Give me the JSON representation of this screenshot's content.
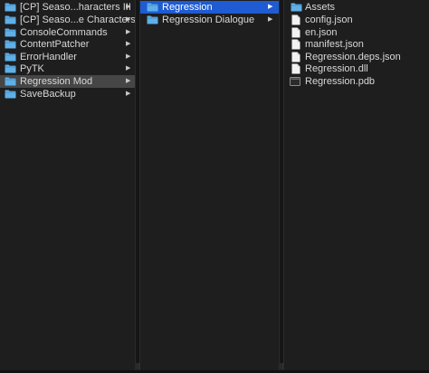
{
  "colors": {
    "background": "#1e1e1f",
    "selected_inactive": "#464646",
    "selected_active": "#1f5bd2",
    "folder": "#5fb0e6",
    "text": "#d8d8d8"
  },
  "column1": {
    "items": [
      {
        "label": "[CP] Seaso...haracters III",
        "icon": "folder-icon",
        "chevron": "▶"
      },
      {
        "label": "[CP] Seaso...e Characters",
        "icon": "folder-icon",
        "chevron": "▶"
      },
      {
        "label": "ConsoleCommands",
        "icon": "folder-icon",
        "chevron": "▶"
      },
      {
        "label": "ContentPatcher",
        "icon": "folder-icon",
        "chevron": "▶"
      },
      {
        "label": "ErrorHandler",
        "icon": "folder-icon",
        "chevron": "▶"
      },
      {
        "label": "PyTK",
        "icon": "folder-icon",
        "chevron": "▶"
      },
      {
        "label": "Regression Mod",
        "icon": "folder-icon",
        "chevron": "▶",
        "selected": "inactive"
      },
      {
        "label": "SaveBackup",
        "icon": "folder-icon",
        "chevron": "▶"
      }
    ]
  },
  "column2": {
    "items": [
      {
        "label": "Regression",
        "icon": "folder-icon",
        "chevron": "▶",
        "selected": "active"
      },
      {
        "label": "Regression Dialogue",
        "icon": "folder-icon",
        "chevron": "▶"
      }
    ]
  },
  "column3": {
    "items": [
      {
        "label": "Assets",
        "icon": "folder-icon"
      },
      {
        "label": "config.json",
        "icon": "document-icon"
      },
      {
        "label": "en.json",
        "icon": "document-icon"
      },
      {
        "label": "manifest.json",
        "icon": "document-icon"
      },
      {
        "label": "Regression.deps.json",
        "icon": "document-icon"
      },
      {
        "label": "Regression.dll",
        "icon": "document-icon"
      },
      {
        "label": "Regression.pdb",
        "icon": "binary-file-icon"
      }
    ]
  },
  "resize_handle_glyph": "||"
}
